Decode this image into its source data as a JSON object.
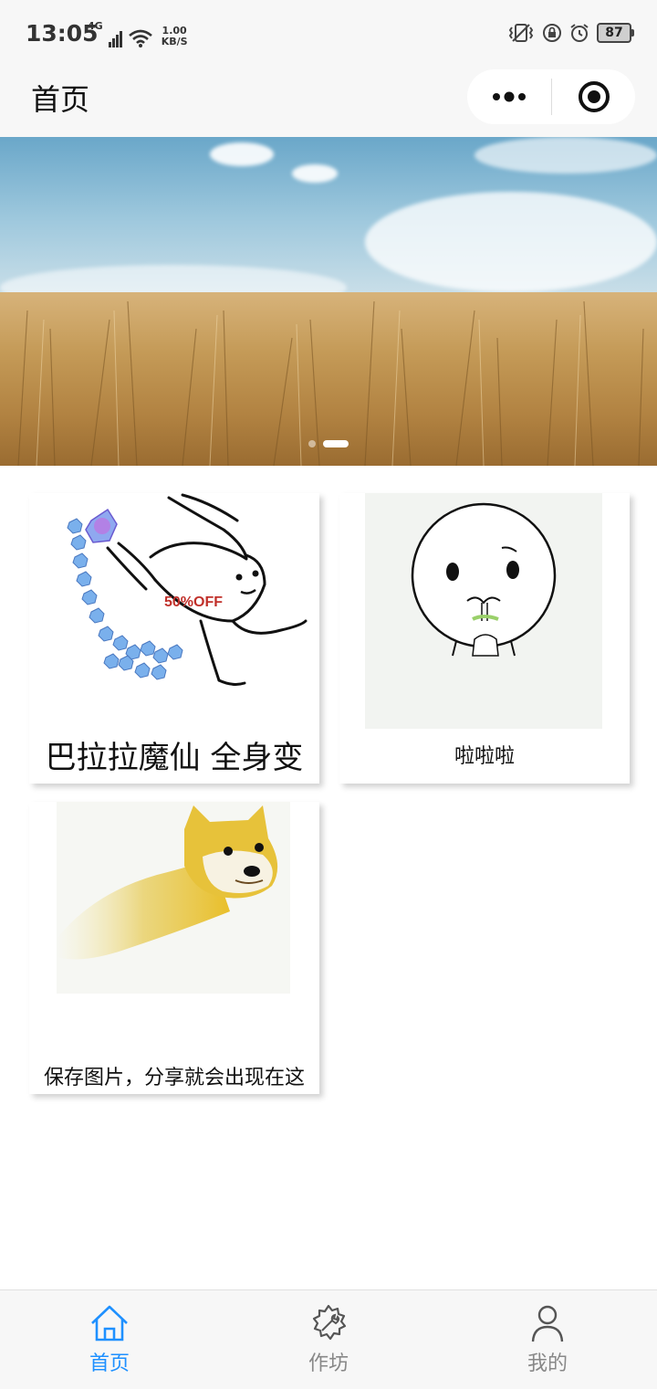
{
  "status_bar": {
    "time": "13:05",
    "network": "4G",
    "speed_value": "1.00",
    "speed_unit": "KB/S",
    "battery": "87"
  },
  "nav": {
    "title": "首页",
    "more_icon": "more-dots-icon",
    "close_icon": "target-circle-icon"
  },
  "banner": {
    "slide_count": 2,
    "active_index": 1
  },
  "cards": [
    {
      "caption": "巴拉拉魔仙 全身变",
      "image": "rabbit-sketch"
    },
    {
      "caption": "啦啦啦",
      "image": "round-face-sketch"
    },
    {
      "caption": "保存图片，分享就会出现在这",
      "image": "flying-doge"
    }
  ],
  "tabs": [
    {
      "label": "首页",
      "icon": "home-icon",
      "active": true
    },
    {
      "label": "作坊",
      "icon": "wrench-gear-icon",
      "active": false
    },
    {
      "label": "我的",
      "icon": "person-icon",
      "active": false
    }
  ],
  "colors": {
    "accent": "#1e90ff",
    "tab_inactive": "#888888",
    "header_bg": "#f7f7f7"
  }
}
